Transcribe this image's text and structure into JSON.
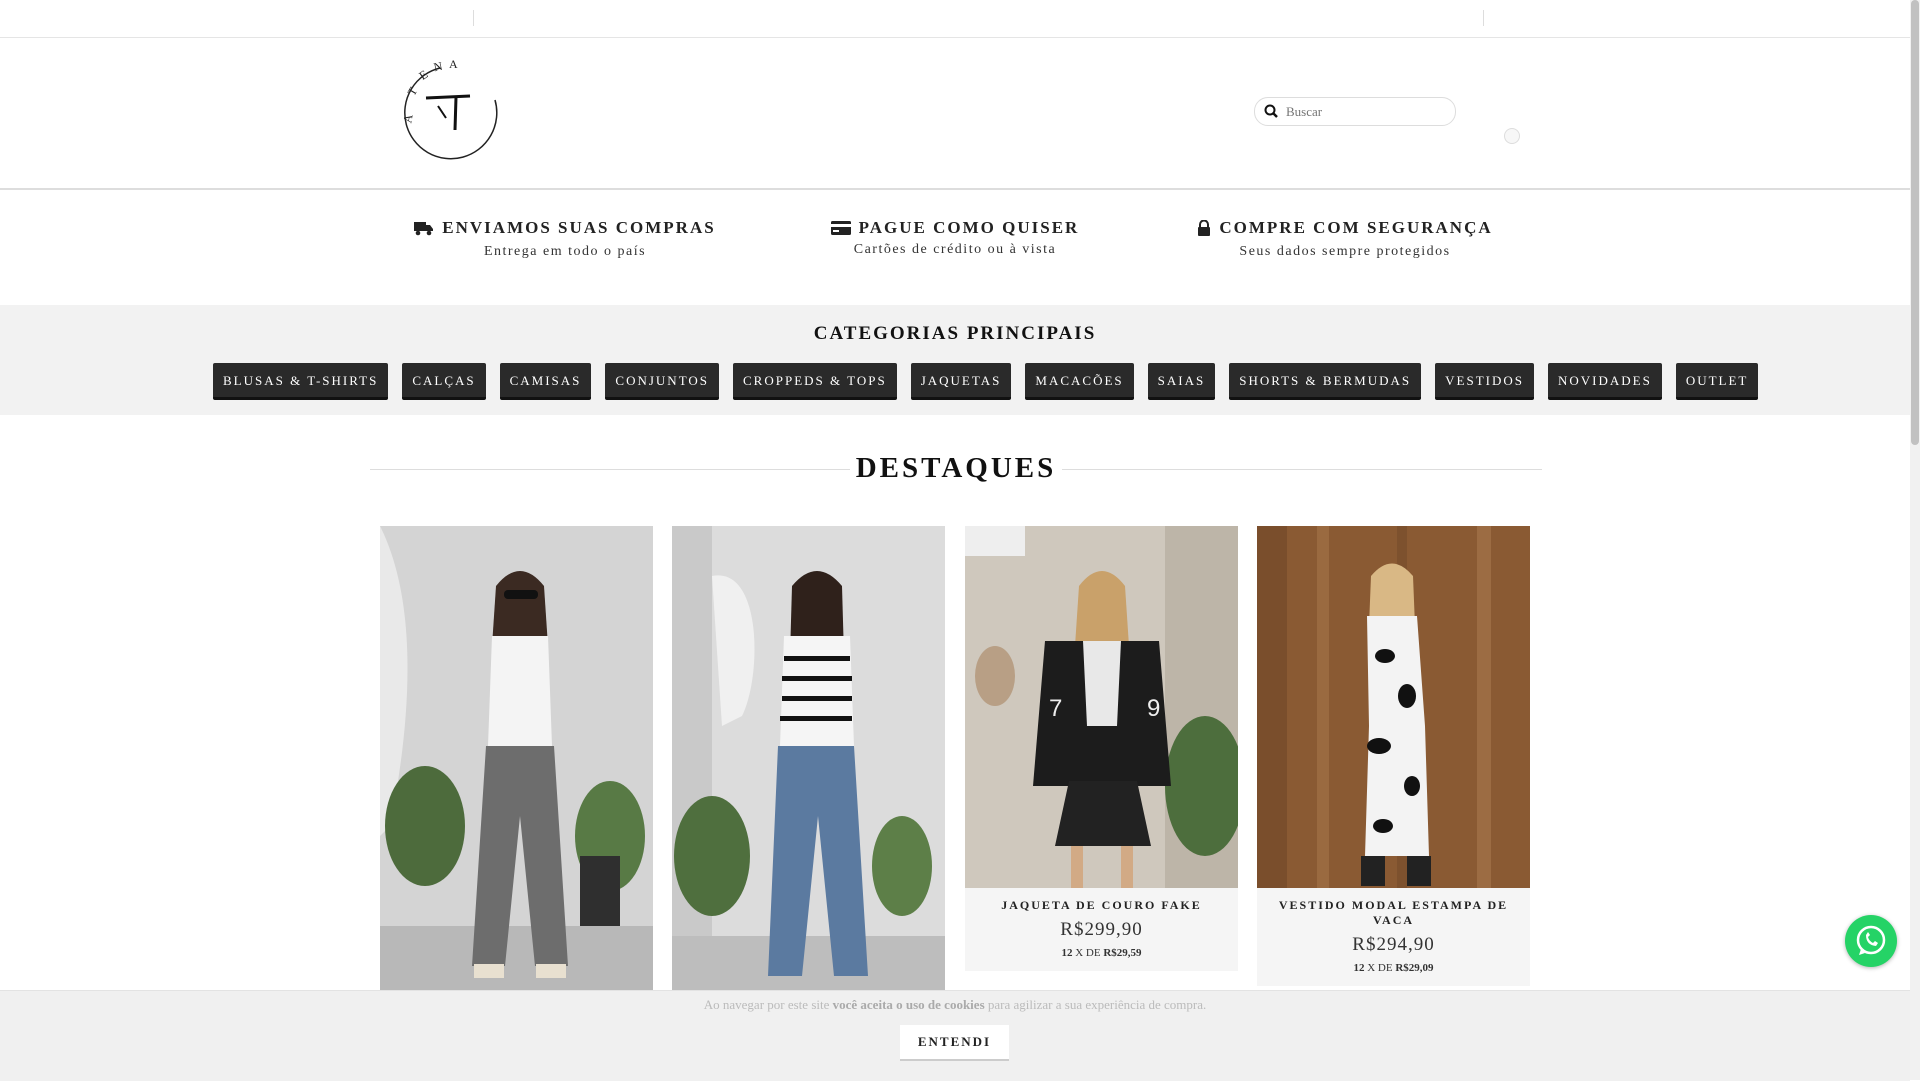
{
  "header": {
    "logo_text": "ATENA",
    "search_placeholder": "Buscar"
  },
  "benefits": [
    {
      "icon": "truck-icon",
      "title": "ENVIAMOS SUAS COMPRAS",
      "subtitle": "Entrega em todo o país"
    },
    {
      "icon": "credit-card-icon",
      "title": "PAGUE COMO QUISER",
      "subtitle": "Cartões de crédito ou à vista"
    },
    {
      "icon": "lock-icon",
      "title": "COMPRE COM SEGURANÇA",
      "subtitle": "Seus dados sempre protegidos"
    }
  ],
  "categories": {
    "heading": "CATEGORIAS PRINCIPAIS",
    "items": [
      "BLUSAS & T-SHIRTS",
      "CALÇAS",
      "CAMISAS",
      "CONJUNTOS",
      "CROPPEDS & TOPS",
      "JAQUETAS",
      "MACACÕES",
      "SAIAS",
      "SHORTS & BERMUDAS",
      "VESTIDOS",
      "NOVIDADES",
      "OUTLET"
    ]
  },
  "featured": {
    "heading": "DESTAQUES",
    "products": [
      {
        "name": "",
        "price": "",
        "installments": "",
        "image_desc": "white tank top and grey cargo jeans"
      },
      {
        "name": "",
        "price": "",
        "installments": "",
        "image_desc": "striped knit top and blue cargo jeans"
      },
      {
        "name": "JAQUETA DE COURO FAKE",
        "price": "R$299,90",
        "installments_count": "12",
        "installments_sep": " X DE ",
        "installments_value": "R$29,59"
      },
      {
        "name": "VESTIDO MODAL ESTAMPA DE VACA",
        "price": "R$294,90",
        "installments_count": "12",
        "installments_sep": " X DE ",
        "installments_value": "R$29,09"
      }
    ]
  },
  "cookie": {
    "text_before": "Ao navegar por este site ",
    "text_bold": "você aceita o uso de cookies",
    "text_after": " para agilizar a sua experiência de compra.",
    "button": "ENTENDI"
  },
  "colors": {
    "button_bg": "#2a2a2a",
    "categories_bg": "#f2f2f2",
    "whatsapp": "#25d366"
  }
}
